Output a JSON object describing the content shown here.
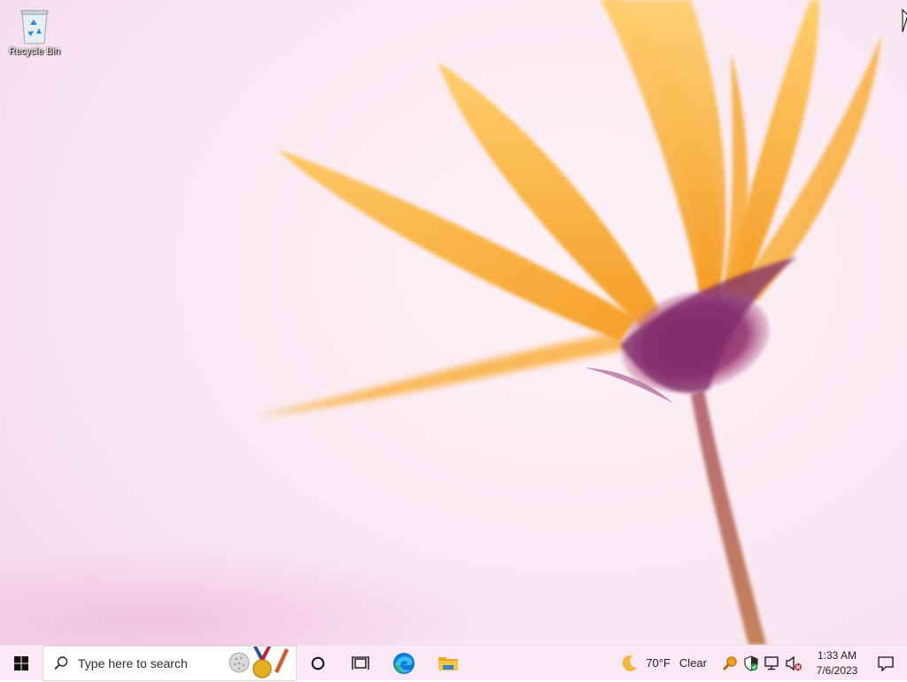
{
  "desktop": {
    "icons": [
      {
        "label": "Recycle Bin",
        "icon": "recycle-bin-icon"
      }
    ]
  },
  "taskbar": {
    "start_icon": "windows-logo-icon",
    "search": {
      "placeholder": "Type here to search",
      "icon": "search-icon",
      "highlight_icon": "golf-medal-icon"
    },
    "cortana_icon": "cortana-circle-icon",
    "taskview_icon": "task-view-icon",
    "pinned": [
      {
        "name": "Microsoft Edge",
        "icon": "edge-icon"
      },
      {
        "name": "File Explorer",
        "icon": "folder-icon"
      }
    ],
    "weather": {
      "icon": "moon-icon",
      "temperature": "70°F",
      "condition": "Clear"
    },
    "tray": [
      {
        "icon": "magnifier-tray-icon"
      },
      {
        "icon": "security-shield-icon"
      },
      {
        "icon": "network-icon"
      },
      {
        "icon": "volume-muted-icon"
      }
    ],
    "clock": {
      "time": "1:33 AM",
      "date": "7/6/2023"
    },
    "notification_icon": "notification-icon"
  },
  "colors": {
    "taskbar_bg": "#fae9f2",
    "petal": "#f7b23a",
    "flower_center": "#7a2e6e",
    "edge_blue": "#0f7ad8",
    "folder_yellow": "#f6c543"
  }
}
